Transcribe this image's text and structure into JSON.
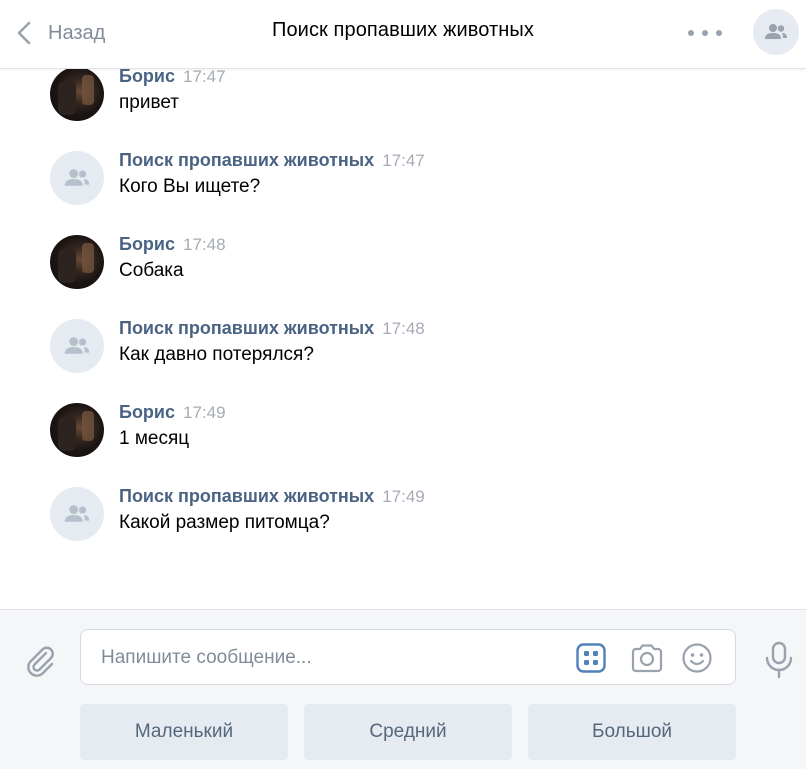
{
  "header": {
    "back_label": "Назад",
    "title": "Поиск пропавших животных"
  },
  "messages": [
    {
      "author": "Борис",
      "time": "17:47",
      "text": "привет",
      "avatar": "user-photo"
    },
    {
      "author": "Поиск пропавших животных",
      "time": "17:47",
      "text": "Кого Вы ищете?",
      "avatar": "group-icon"
    },
    {
      "author": "Борис",
      "time": "17:48",
      "text": "Собака",
      "avatar": "user-photo"
    },
    {
      "author": "Поиск пропавших животных",
      "time": "17:48",
      "text": "Как давно потерялся?",
      "avatar": "group-icon"
    },
    {
      "author": "Борис",
      "time": "17:49",
      "text": "1 месяц",
      "avatar": "user-photo"
    },
    {
      "author": "Поиск пропавших животных",
      "time": "17:49",
      "text": "Какой размер питомца?",
      "avatar": "group-icon"
    }
  ],
  "composer": {
    "placeholder": "Напишите сообщение...",
    "value": ""
  },
  "keyboard": {
    "buttons": [
      "Маленький",
      "Средний",
      "Большой"
    ]
  },
  "colors": {
    "author": "#4a6383",
    "time": "#a5acb6",
    "accent": "#5181b8",
    "icon_gray": "#99a2ad",
    "keyboard_bg": "#e5ebf1"
  }
}
